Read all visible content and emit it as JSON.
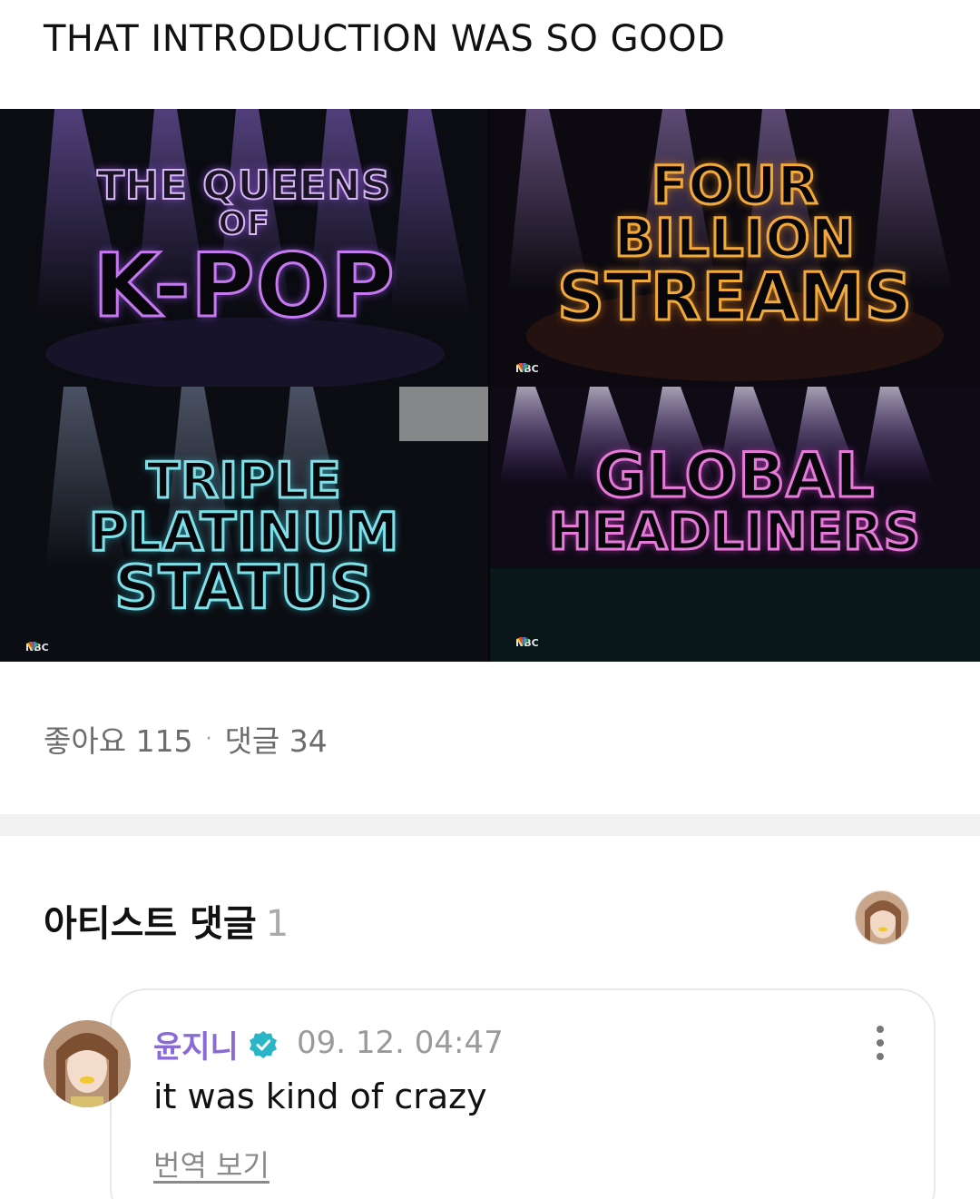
{
  "post": {
    "title": "THAT INTRODUCTION WAS SO GOOD"
  },
  "image_grid": {
    "tiles": [
      {
        "lines": [
          "THE QUEENS",
          "OF",
          "K-POP"
        ],
        "outline_color": "#c678f0",
        "glow_color": "#4a2a7a",
        "logo": ""
      },
      {
        "lines": [
          "FOUR",
          "BILLION",
          "STREAMS"
        ],
        "outline_color": "#f2a93b",
        "glow_color": "#5a3a10",
        "logo": "NBC"
      },
      {
        "lines": [
          "TRIPLE",
          "PLATINUM",
          "STATUS"
        ],
        "outline_color": "#7fe0e8",
        "glow_color": "#1f4a5a",
        "logo": "NBC"
      },
      {
        "lines": [
          "GLOBAL",
          "HEADLINERS"
        ],
        "outline_color": "#e57ad8",
        "glow_color": "#5a1f55",
        "logo": "NBC"
      }
    ]
  },
  "stats": {
    "likes_label": "좋아요 115",
    "separator": "·",
    "comments_label": "댓글 34"
  },
  "artist_comments": {
    "title": "아티스트 댓글",
    "count": "1"
  },
  "comment": {
    "author": "윤지니",
    "timestamp": "09. 12. 04:47",
    "text": "it was kind of crazy",
    "translate_label": "번역 보기"
  },
  "colors": {
    "author_purple": "#8a6bd6",
    "verified_teal": "#2bb6c8"
  },
  "icons": {
    "verified": "verified-badge-icon",
    "more": "more-vertical-icon"
  }
}
